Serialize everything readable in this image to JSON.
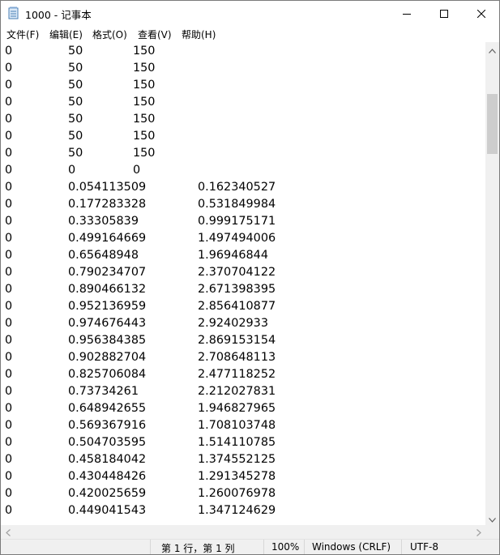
{
  "window": {
    "title": "1000 - 记事本",
    "minimize_glyph": "—",
    "maximize_glyph": "□",
    "close_glyph": "✕"
  },
  "menu": [
    "文件(F)",
    "编辑(E)",
    "格式(O)",
    "查看(V)",
    "帮助(H)"
  ],
  "rows": [
    [
      "0",
      "50",
      "150"
    ],
    [
      "0",
      "50",
      "150"
    ],
    [
      "0",
      "50",
      "150"
    ],
    [
      "0",
      "50",
      "150"
    ],
    [
      "0",
      "50",
      "150"
    ],
    [
      "0",
      "50",
      "150"
    ],
    [
      "0",
      "50",
      "150"
    ],
    [
      "0",
      "0",
      "0"
    ],
    [
      "0",
      "0.054113509",
      "0.162340527"
    ],
    [
      "0",
      "0.177283328",
      "0.531849984"
    ],
    [
      "0",
      "0.33305839",
      "0.999175171"
    ],
    [
      "0",
      "0.499164669",
      "1.497494006"
    ],
    [
      "0",
      "0.65648948",
      "1.96946844"
    ],
    [
      "0",
      "0.790234707",
      "2.370704122"
    ],
    [
      "0",
      "0.890466132",
      "2.671398395"
    ],
    [
      "0",
      "0.952136959",
      "2.856410877"
    ],
    [
      "0",
      "0.974676443",
      "2.92402933"
    ],
    [
      "0",
      "0.956384385",
      "2.869153154"
    ],
    [
      "0",
      "0.902882704",
      "2.708648113"
    ],
    [
      "0",
      "0.825706084",
      "2.477118252"
    ],
    [
      "0",
      "0.73734261",
      "2.212027831"
    ],
    [
      "0",
      "0.648942655",
      "1.946827965"
    ],
    [
      "0",
      "0.569367916",
      "1.708103748"
    ],
    [
      "0",
      "0.504703595",
      "1.514110785"
    ],
    [
      "0",
      "0.458184042",
      "1.374552125"
    ],
    [
      "0",
      "0.430448426",
      "1.291345278"
    ],
    [
      "0",
      "0.420025659",
      "1.260076978"
    ],
    [
      "0",
      "0.449041543",
      "1.347124629"
    ]
  ],
  "status": {
    "position": "第 1 行，第 1 列",
    "zoom": "100%",
    "line_ending": "Windows (CRLF)",
    "encoding": "UTF-8"
  }
}
